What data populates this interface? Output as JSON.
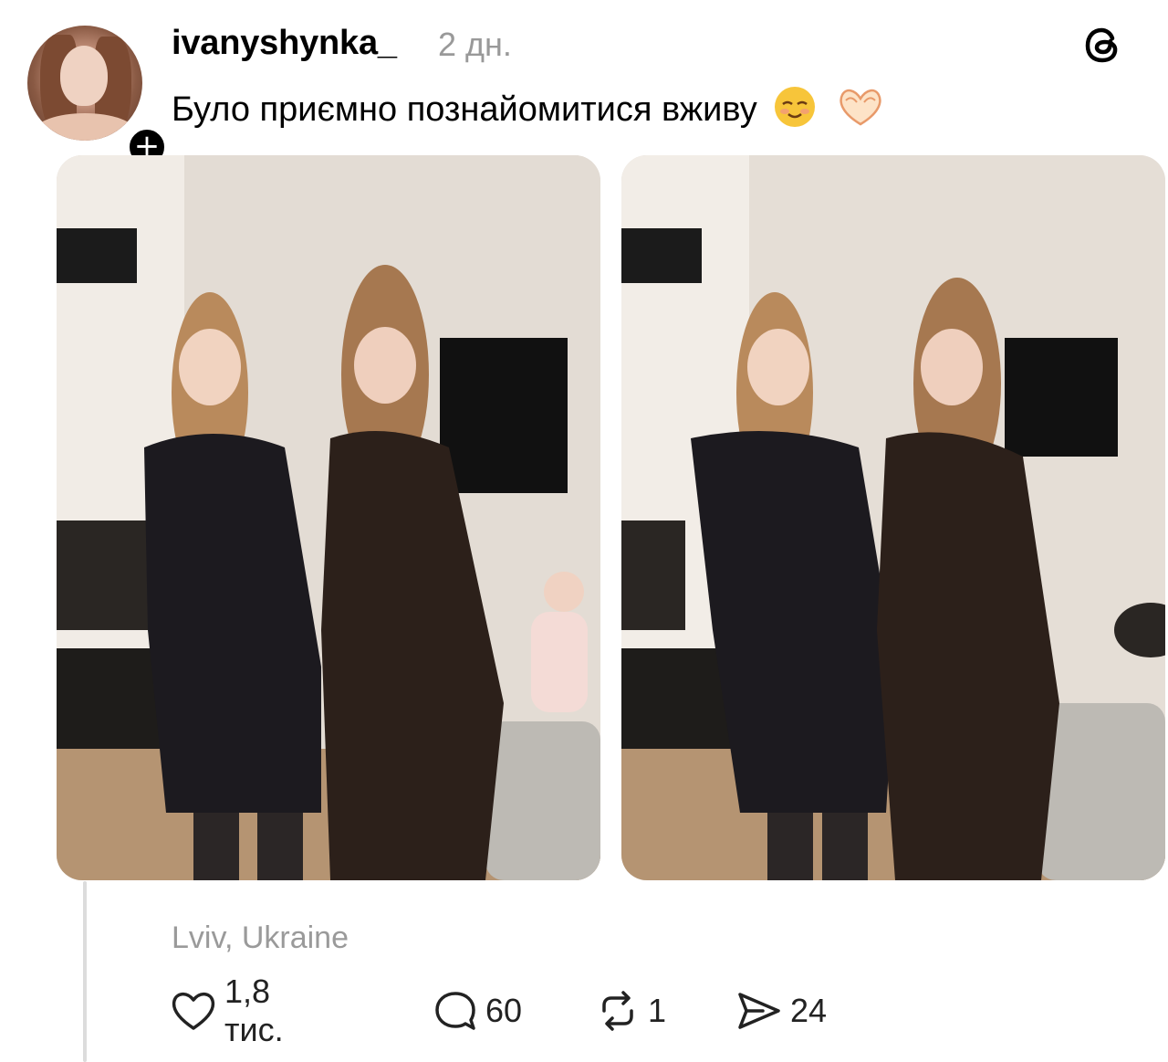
{
  "post": {
    "username": "ivanyshynka_",
    "time": "2 дн.",
    "caption": "Було приємно познайомитися вживу",
    "caption_emojis": [
      "smiling-face-icon",
      "heart-hands-icon"
    ],
    "location": "Lviv, Ukraine",
    "images": [
      {
        "name": "photo-1"
      },
      {
        "name": "photo-2"
      }
    ]
  },
  "actions": {
    "likes": "1,8 тис.",
    "comments": "60",
    "reposts": "1",
    "shares": "24"
  },
  "icons": {
    "app_logo": "threads-logo-icon",
    "follow": "plus-icon",
    "like": "heart-icon",
    "comment": "comment-bubble-icon",
    "repost": "repost-icon",
    "share": "send-icon"
  },
  "colors": {
    "secondary_text": "#999999",
    "thread_line": "#dcdcdc"
  }
}
